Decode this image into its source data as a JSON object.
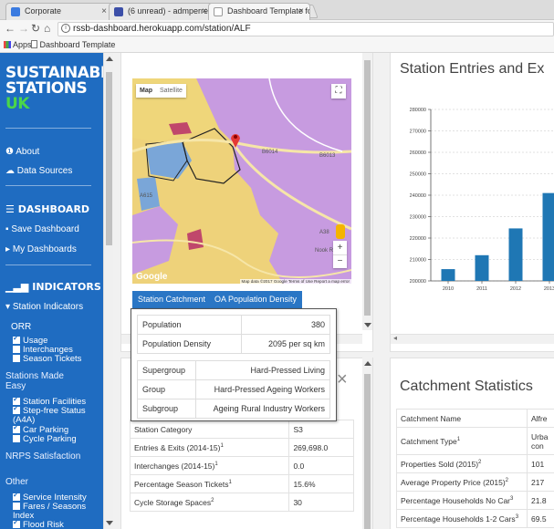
{
  "browser": {
    "tabs": [
      {
        "label": "Corporate",
        "color": "#3b7be0"
      },
      {
        "label": "(6 unread) - admperret@",
        "color": "#3c4fa8"
      },
      {
        "label": "Dashboard Template fo",
        "color": "#999999"
      }
    ],
    "url": "rssb-dashboard.herokuapp.com/station/ALF",
    "bookmarks": [
      "Apps",
      "Dashboard Template"
    ]
  },
  "sidebar": {
    "brand_line1": "SUSTAINABLE",
    "brand_line2": "STATIONS",
    "brand_line3": "UK",
    "about": "About",
    "data_sources": "Data Sources",
    "dashboard_head": "DASHBOARD",
    "save_dashboard": "Save Dashboard",
    "my_dashboards": "My Dashboards",
    "indicators_head": "INDICATORS",
    "station_indicators": "Station Indicators",
    "orr": "ORR",
    "usage": "Usage",
    "interchanges": "Interchanges",
    "season_tickets": "Season Tickets",
    "stations_made_easy": "Stations Made Easy",
    "station_facilities": "Station Facilities",
    "step_free": "Step-free Status (A4A)",
    "car_parking": "Car Parking",
    "cycle_parking": "Cycle Parking",
    "nrps": "NRPS Satisfaction",
    "other": "Other",
    "service_intensity": "Service Intensity",
    "fares_seasons": "Fares / Seasons Index",
    "flood_risk": "Flood Risk"
  },
  "map_panel": {
    "map_label": "Map",
    "satellite_label": "Satellite",
    "road_label_1": "B6014",
    "road_label_2": "B6013",
    "road_label_3": "A38",
    "road_label_4": "Nook Rd",
    "road_label_5": "A615",
    "google": "Google",
    "attribution": "Map data ©2017 Google   Terms of Use   Report a map error",
    "zoom_in": "+",
    "zoom_out": "−",
    "tab_catchment": "Station Catchment",
    "tab_oa": "OA Population Density"
  },
  "popup": {
    "rows1": [
      {
        "label": "Population",
        "value": "380"
      },
      {
        "label": "Population Density",
        "value": "2095 per sq km"
      }
    ],
    "rows2": [
      {
        "label": "Supergroup",
        "value": "Hard-Pressed Living"
      },
      {
        "label": "Group",
        "value": "Hard-Pressed Ageing Workers"
      },
      {
        "label": "Subgroup",
        "value": "Ageing Rural Industry Workers"
      }
    ]
  },
  "station_table": {
    "close": "×",
    "rows": [
      {
        "label": "Station Category",
        "sup": "",
        "value": "S3"
      },
      {
        "label": "Entries & Exits (2014-15)",
        "sup": "1",
        "value": "269,698.0"
      },
      {
        "label": "Interchanges (2014-15)",
        "sup": "1",
        "value": "0.0"
      },
      {
        "label": "Percentage Season Tickets",
        "sup": "1",
        "value": "15.6%"
      },
      {
        "label": "Cycle Storage Spaces",
        "sup": "2",
        "value": "30"
      }
    ]
  },
  "chart_panel": {
    "title": "Station Entries and Ex"
  },
  "chart_data": {
    "type": "bar",
    "title": "Station Entries and Ex",
    "categories": [
      "2010",
      "2011",
      "2012",
      "2013"
    ],
    "values": [
      205500,
      212000,
      224500,
      241000
    ],
    "yticks": [
      "280000",
      "270000",
      "260000",
      "250000",
      "240000",
      "230000",
      "220000",
      "210000",
      "200000"
    ],
    "ylim": [
      200000,
      280000
    ],
    "grid": true,
    "bar_color": "#1f77b4"
  },
  "catchment": {
    "title": "Catchment Statistics",
    "rows": [
      {
        "label": "Catchment Name",
        "sup": "",
        "value": "Alfre"
      },
      {
        "label": "Catchment Type",
        "sup": "1",
        "value": "Urba con"
      },
      {
        "label": "Properties Sold (2015)",
        "sup": "2",
        "value": "101"
      },
      {
        "label": "Average Property Price (2015)",
        "sup": "2",
        "value": "217"
      },
      {
        "label": "Percentage Households No Car",
        "sup": "3",
        "value": "21.8"
      },
      {
        "label": "Percentage Households 1-2 Cars",
        "sup": "3",
        "value": "69.5"
      }
    ]
  }
}
